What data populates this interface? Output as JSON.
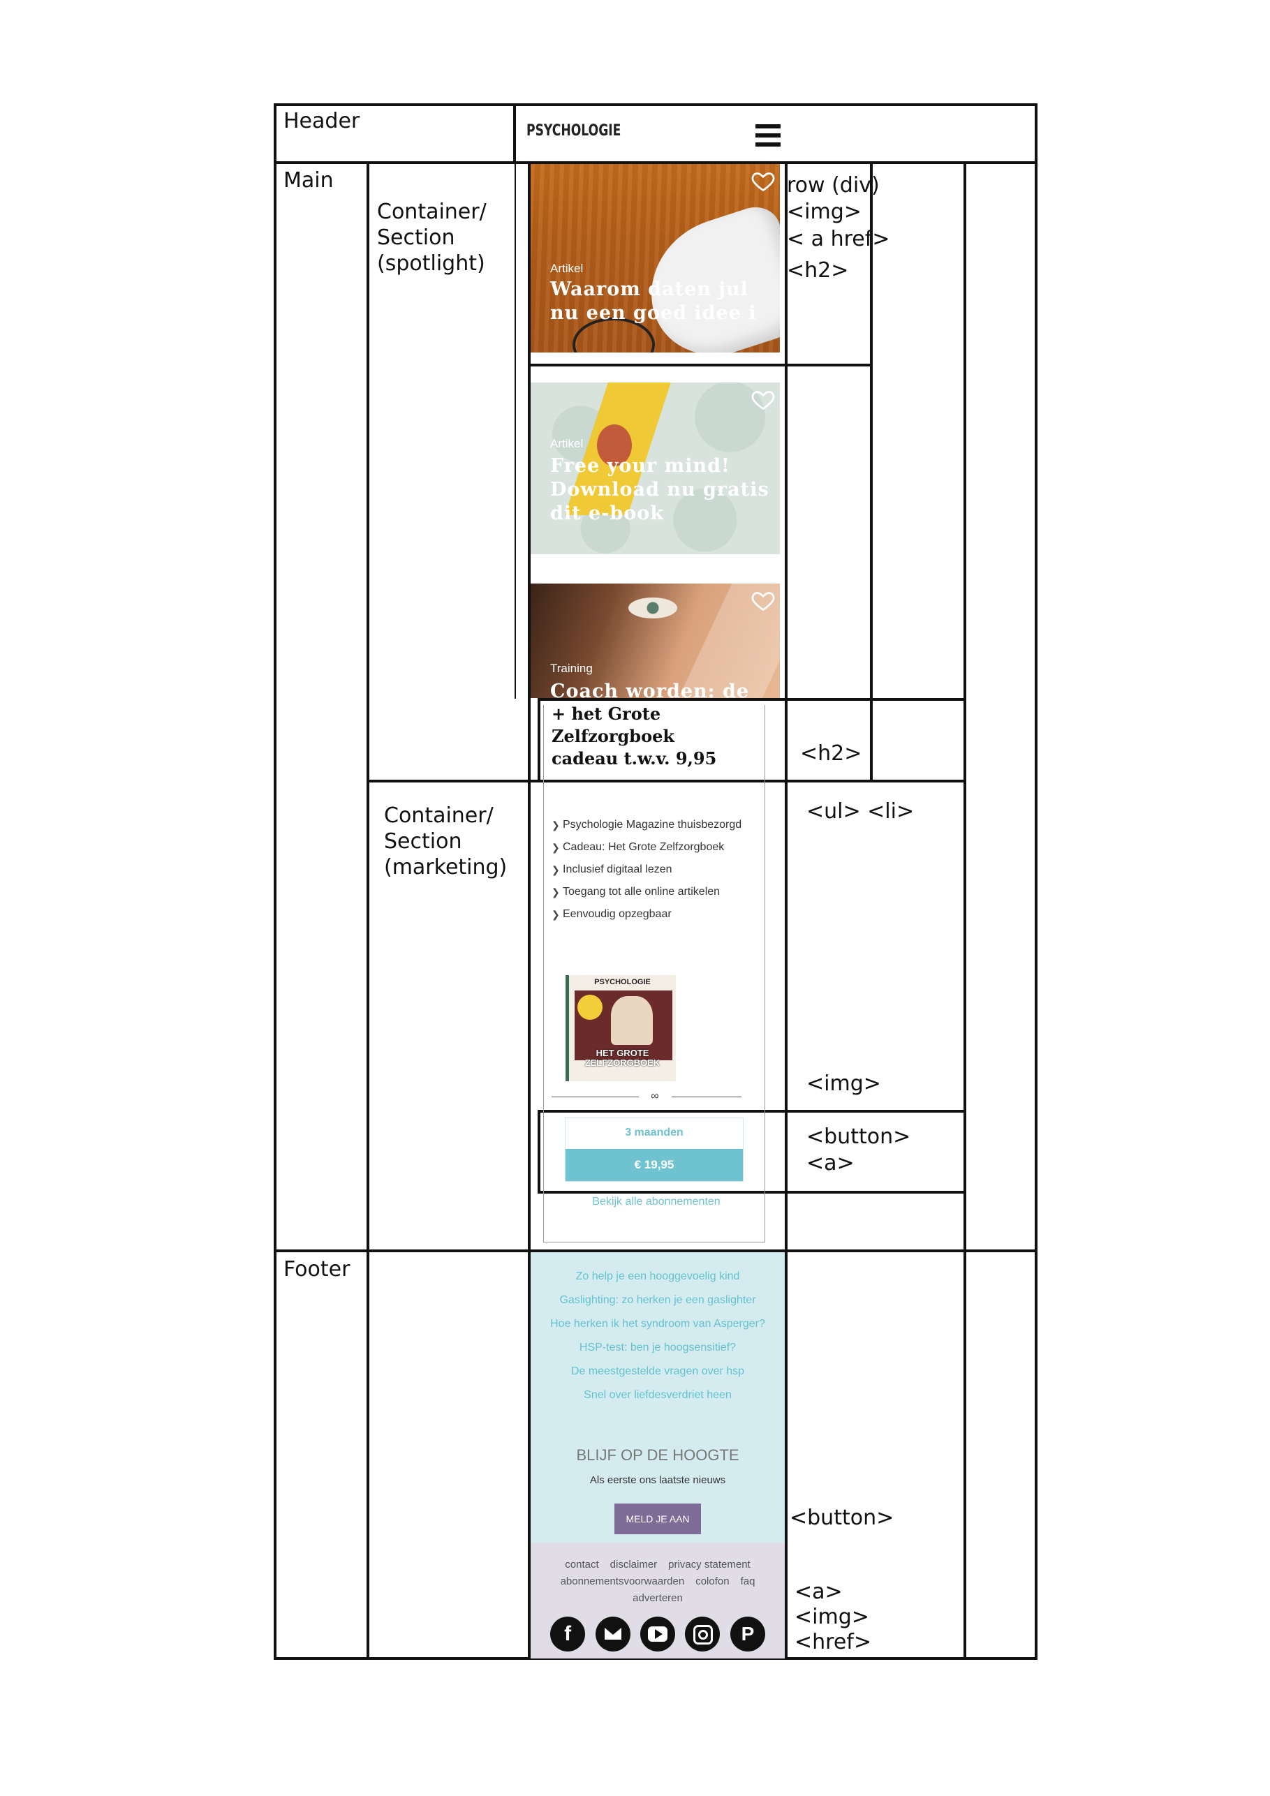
{
  "labels": {
    "header": "Header",
    "main": "Main",
    "footer": "Footer",
    "spotlight_section": [
      "Container/",
      "Section",
      "(spotlight)"
    ],
    "marketing_section": [
      "Container/",
      "Section",
      "(marketing)"
    ],
    "row_annotations": [
      "row (div)",
      "<img>",
      "< a href>",
      "<h2>"
    ],
    "h2_annotation": "<h2>",
    "list_annotation": "<ul> <li>",
    "img_annotation": "<img>",
    "button_annotation": [
      "<button>",
      "<a>"
    ],
    "footer_button_annotation": "<button>",
    "footer_links_annotation": [
      "<a>",
      "<img>",
      "<href>"
    ]
  },
  "mockup": {
    "logo": "PSYCHOLOGIE",
    "cards": [
      {
        "category": "Artikel",
        "title_lines": [
          "Waarom daten jul",
          "nu een goed idee i"
        ]
      },
      {
        "category": "Artikel",
        "title_lines": [
          "Free your mind!",
          "Download nu gratis",
          "dit e-book"
        ]
      },
      {
        "category": "Training",
        "title_lines": [
          "Coach worden: de"
        ]
      }
    ],
    "offer_title_lines": [
      "+ het Grote",
      "Zelfzorgboek",
      "cadeau t.w.v. 9,95"
    ],
    "benefits": [
      "Psychologie Magazine thuisbezorgd",
      "Cadeau: Het Grote Zelfzorgboek",
      "Inclusief digitaal lezen",
      "Toegang tot alle online artikelen",
      "Eenvoudig opzegbaar"
    ],
    "book": {
      "brand": "PSYCHOLOGIE",
      "title_lines": [
        "HET GROTE",
        "ZELFZORGBOEK"
      ]
    },
    "subscription": {
      "period": "3 maanden",
      "price": "€ 19,95",
      "all_link": "Bekijk alle abonnementen"
    },
    "footer_links": [
      "Zo help je een hooggevoelig kind",
      "Gaslighting: zo herken je een gaslighter",
      "Hoe herken ik het syndroom van Asperger?",
      "HSP-test: ben je hoogsensitief?",
      "De meestgestelde vragen over hsp",
      "Snel over liefdesverdriet heen"
    ],
    "newsletter": {
      "title": "BLIJF OP DE HOOGTE",
      "subtitle": "Als eerste ons laatste nieuws",
      "button": "MELD JE AAN"
    },
    "legal_links_row1": [
      "contact",
      "disclaimer",
      "privacy statement"
    ],
    "legal_links_row2": [
      "abonnementsvoorwaarden",
      "colofon",
      "faq"
    ],
    "legal_links_row3": [
      "adverteren"
    ],
    "social_icons": [
      "facebook-icon",
      "mail-icon",
      "youtube-icon",
      "instagram-icon",
      "pinterest-icon"
    ],
    "colors": {
      "accent": "#6fc2d0",
      "footer_bg": "#d4ecf0",
      "legal_bg": "#e0dde6",
      "newsletter_button": "#7e6b96"
    }
  }
}
